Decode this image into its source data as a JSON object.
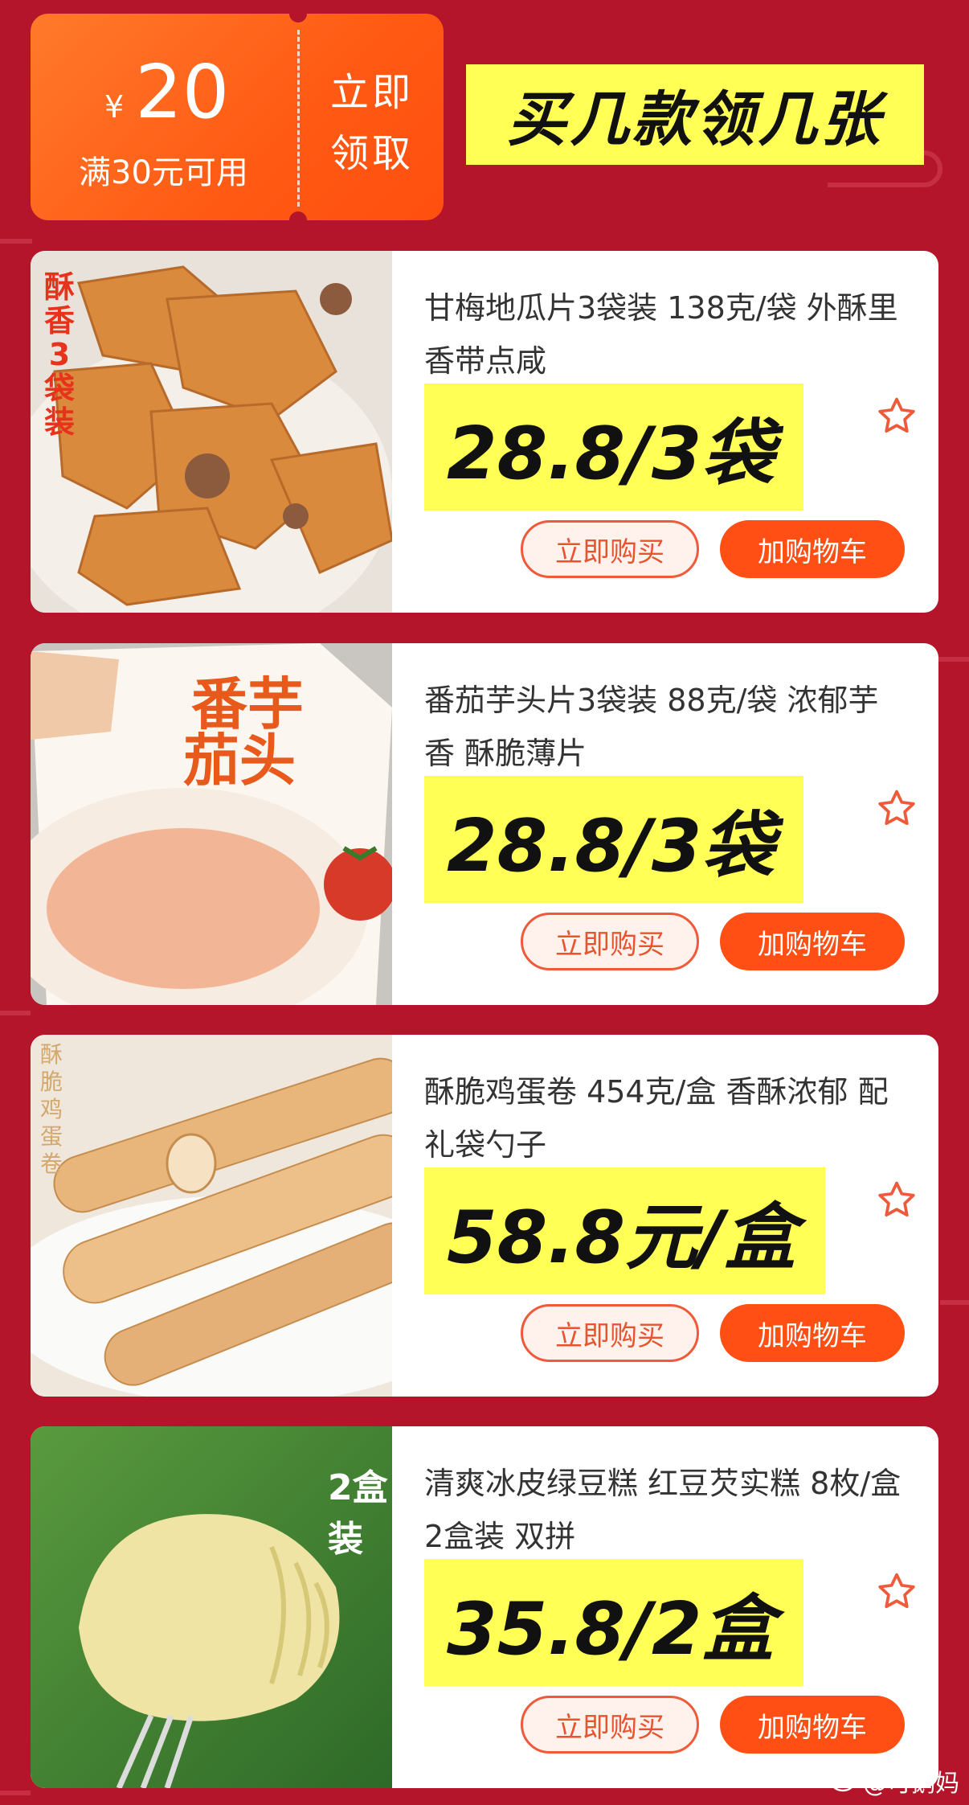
{
  "coupon": {
    "currency": "¥",
    "amount": "20",
    "condition": "满30元可用",
    "claim_line1": "立即",
    "claim_line2": "领取"
  },
  "headline": "买几款领几张",
  "products": [
    {
      "badge": "酥香3袋装",
      "title": "甘梅地瓜片3袋装 138克/袋 外酥里香带点咸",
      "price": "28.8/3袋",
      "buy_label": "立即购买",
      "cart_label": "加购物车"
    },
    {
      "badge": "番茄芋头片",
      "title": "番茄芋头片3袋装 88克/袋 浓郁芋香 酥脆薄片",
      "price": "28.8/3袋",
      "buy_label": "立即购买",
      "cart_label": "加购物车"
    },
    {
      "badge": "酥脆鸡蛋卷",
      "title": "酥脆鸡蛋卷 454克/盒 香酥浓郁 配礼袋勺子",
      "price": "58.8元/盒",
      "buy_label": "立即购买",
      "cart_label": "加购物车"
    },
    {
      "badge": "2盒装",
      "title": "清爽冰皮绿豆糕 红豆芡实糕 8枚/盒 2盒装 双拼",
      "price": "35.8/2盒",
      "buy_label": "立即购买",
      "cart_label": "加购物车"
    }
  ],
  "watermark": "@可鹅妈",
  "colors": {
    "background": "#b5152b",
    "coupon": "#ff5a14",
    "highlight": "#ffff55",
    "cart_button": "#ff4f14",
    "star": "#ee5a3a"
  }
}
